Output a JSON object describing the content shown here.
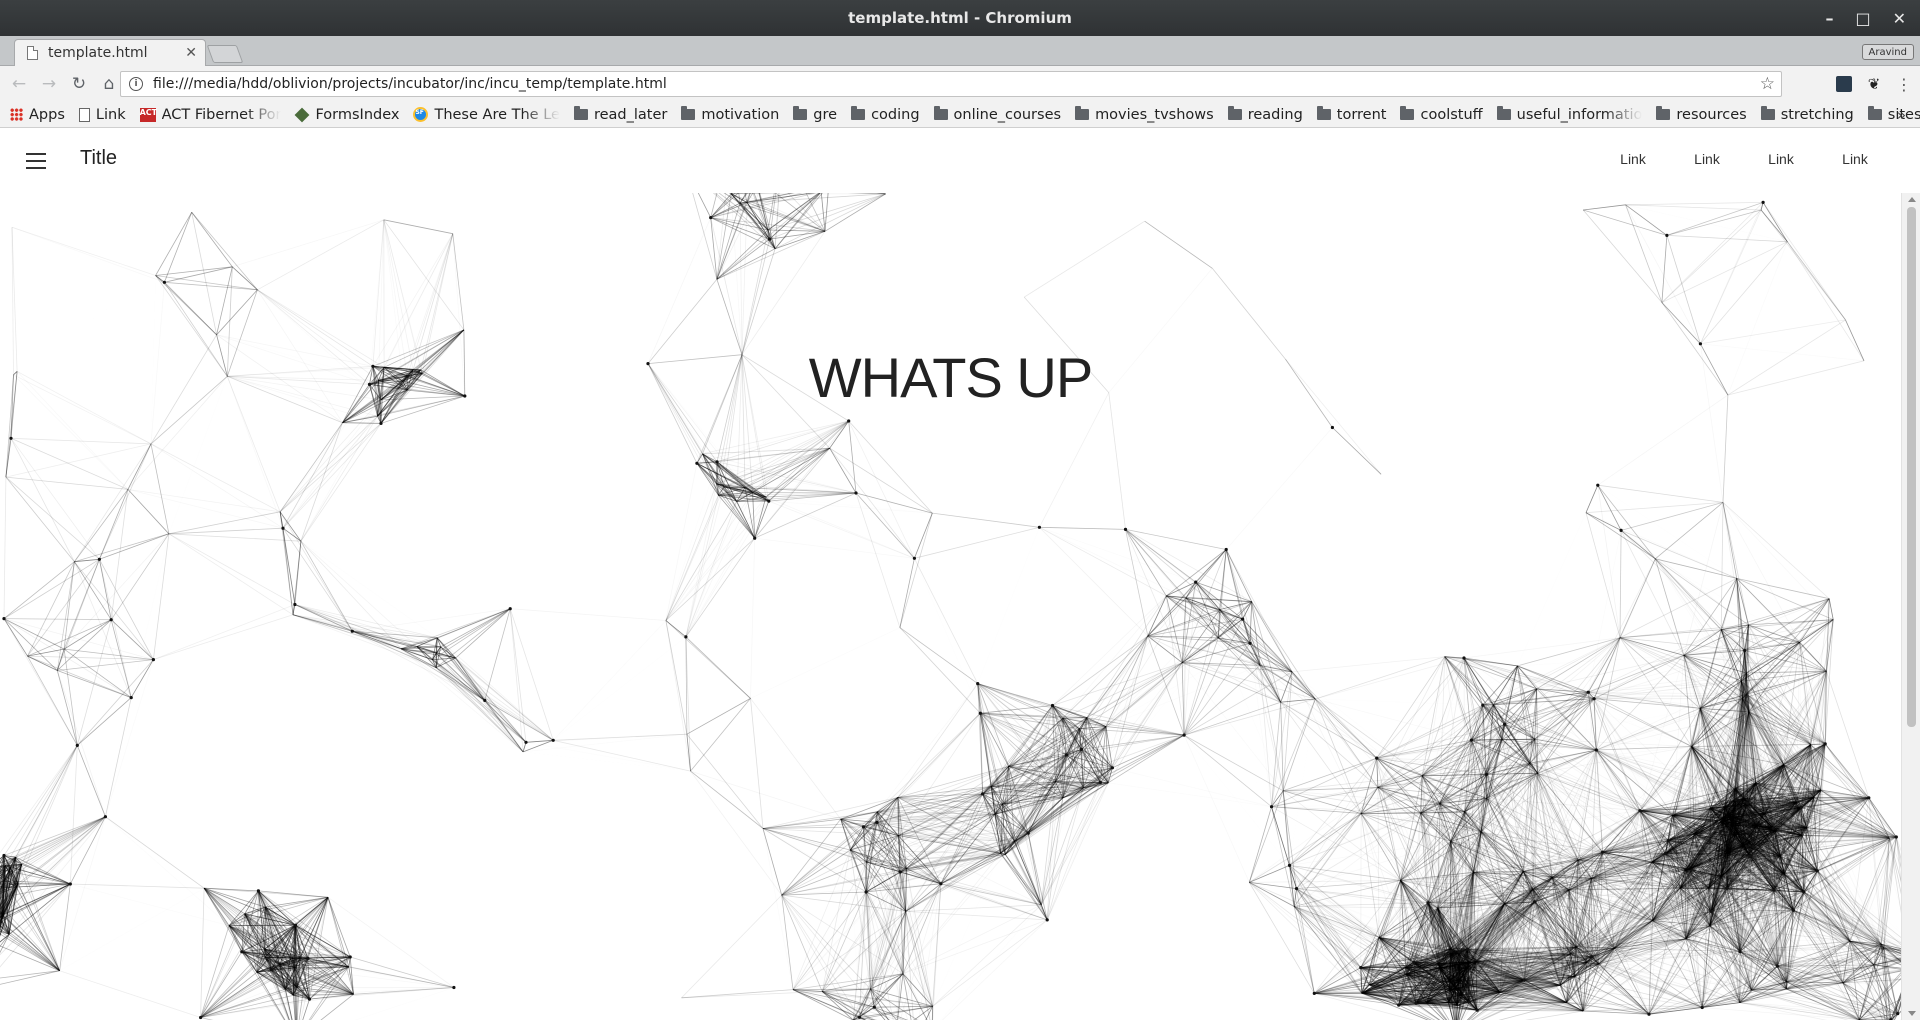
{
  "window": {
    "title": "template.html - Chromium",
    "controls": {
      "minimize": "–",
      "maximize": "□",
      "close": "✕"
    }
  },
  "tab": {
    "label": "template.html",
    "close": "✕"
  },
  "profile": {
    "name": "Aravind"
  },
  "toolbar": {
    "back": "←",
    "forward": "→",
    "reload": "↻",
    "home": "⌂",
    "url": "file:///media/hdd/oblivion/projects/incubator/inc/incu_temp/template.html",
    "star": "☆",
    "menu": "⋮"
  },
  "bookmarks": {
    "items": [
      {
        "label": "Apps",
        "icon": "apps-grid-icon"
      },
      {
        "label": "Link",
        "icon": "page-icon"
      },
      {
        "label": "ACT Fibernet Por",
        "icon": "act-icon"
      },
      {
        "label": "FormsIndex",
        "icon": "forms-icon"
      },
      {
        "label": "These Are The Le",
        "icon": "sf-icon"
      },
      {
        "label": "read_later",
        "icon": "folder-icon"
      },
      {
        "label": "motivation",
        "icon": "folder-icon"
      },
      {
        "label": "gre",
        "icon": "folder-icon"
      },
      {
        "label": "coding",
        "icon": "folder-icon"
      },
      {
        "label": "online_courses",
        "icon": "folder-icon"
      },
      {
        "label": "movies_tvshows",
        "icon": "folder-icon"
      },
      {
        "label": "reading",
        "icon": "folder-icon"
      },
      {
        "label": "torrent",
        "icon": "folder-icon"
      },
      {
        "label": "coolstuff",
        "icon": "folder-icon"
      },
      {
        "label": "useful_informatio",
        "icon": "folder-icon"
      },
      {
        "label": "resources",
        "icon": "folder-icon"
      },
      {
        "label": "stretching",
        "icon": "folder-icon"
      },
      {
        "label": "sites",
        "icon": "folder-icon"
      }
    ],
    "more": "»"
  },
  "page": {
    "appbar": {
      "title": "Title",
      "links": [
        "Link",
        "Link",
        "Link",
        "Link"
      ]
    },
    "hero": "WHATS UP"
  }
}
